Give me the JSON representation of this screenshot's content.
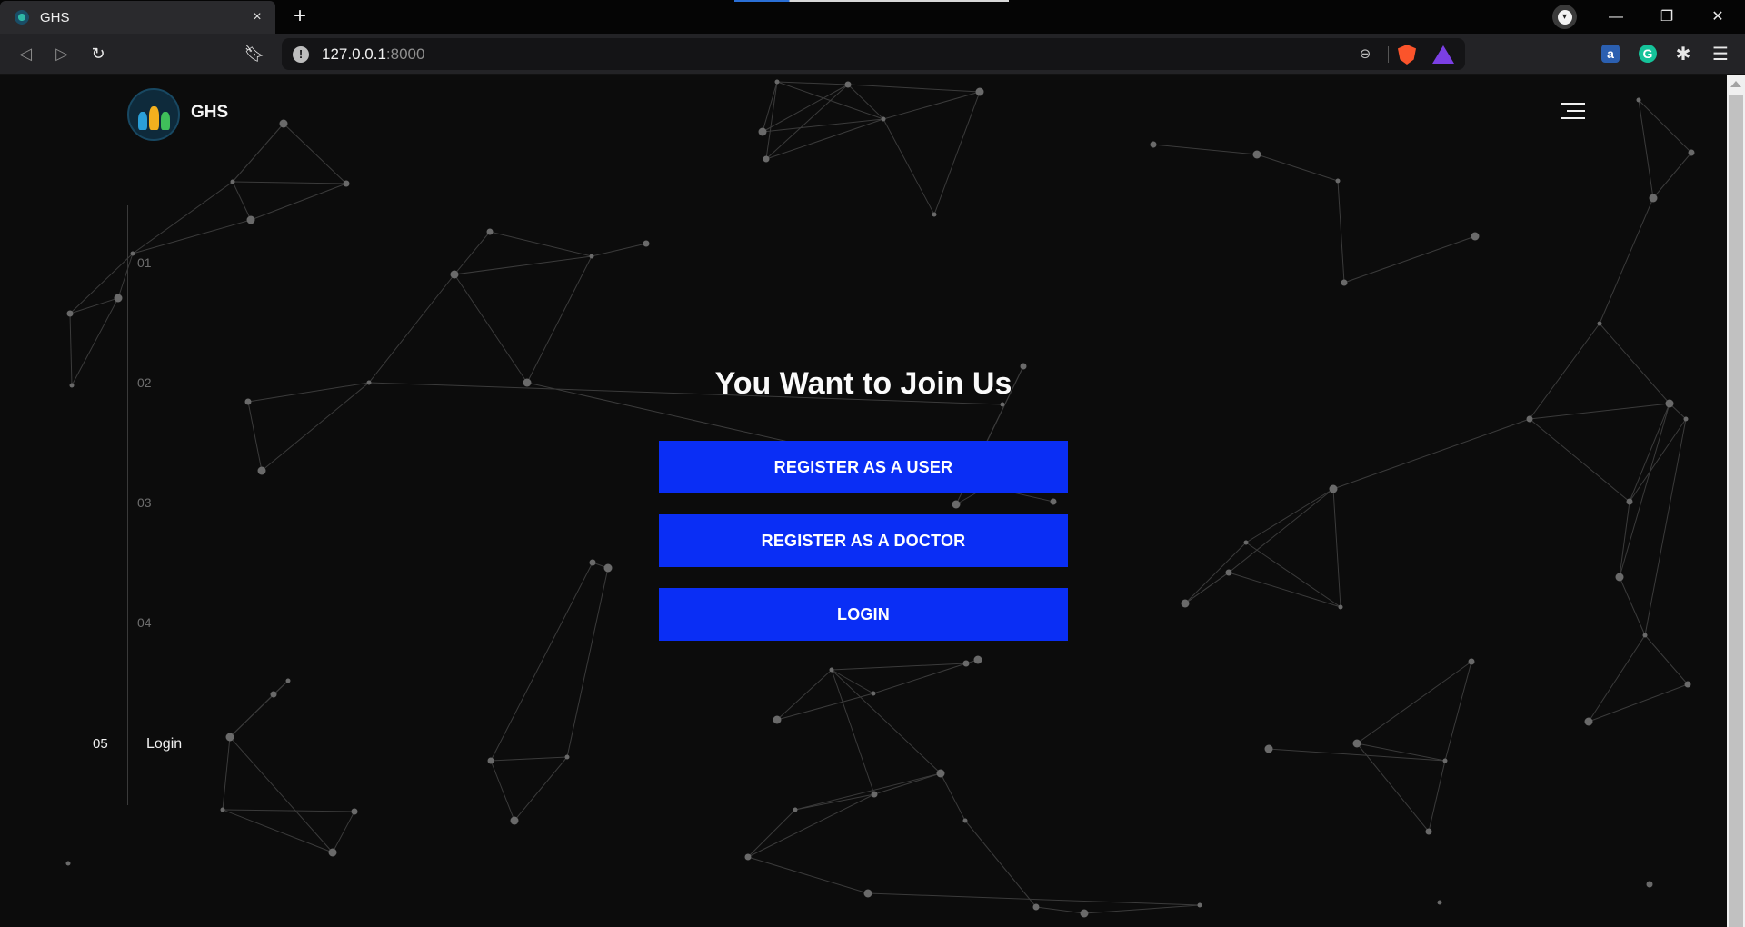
{
  "browser": {
    "tab_title": "GHS",
    "tab_close": "×",
    "new_tab": "+",
    "url_host": "127.0.0.1",
    "url_port": ":8000",
    "info_glyph": "!",
    "window_controls": {
      "minimize": "—",
      "restore": "❐",
      "close": "✕"
    },
    "icons": [
      "back-icon",
      "forward-icon",
      "reload-icon",
      "bookmark-icon",
      "info-icon",
      "zoom-out-icon",
      "brave-shields-icon",
      "brave-rewards-icon",
      "extension-a-icon",
      "grammarly-icon",
      "extensions-icon",
      "menu-icon",
      "profile-icon"
    ]
  },
  "site": {
    "brand": "GHS",
    "side_nav": [
      {
        "num": "01",
        "label": "",
        "active": false
      },
      {
        "num": "02",
        "label": "",
        "active": false
      },
      {
        "num": "03",
        "label": "",
        "active": false
      },
      {
        "num": "04",
        "label": "",
        "active": false
      },
      {
        "num": "05",
        "label": "Login",
        "active": true
      }
    ]
  },
  "main": {
    "title": "You Want to Join Us",
    "buttons": {
      "register_user": "REGISTER AS A USER",
      "register_doctor": "REGISTER AS A DOCTOR",
      "login": "LOGIN"
    }
  },
  "colors": {
    "background": "#0c0c0c",
    "button": "#0a2ef5",
    "button_text": "#ffffff",
    "network": "#6a6a6a"
  }
}
